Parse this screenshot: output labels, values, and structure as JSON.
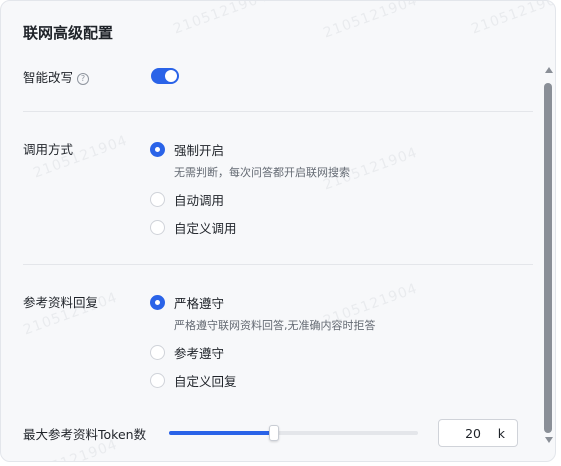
{
  "panel": {
    "title": "联网高级配置",
    "watermark": "2105121904"
  },
  "smart_rewrite": {
    "label": "智能改写",
    "help_icon": "?",
    "enabled": true
  },
  "call_mode": {
    "label": "调用方式",
    "options": [
      {
        "label": "强制开启",
        "selected": true,
        "description": "无需判断，每次问答都开启联网搜索"
      },
      {
        "label": "自动调用",
        "selected": false
      },
      {
        "label": "自定义调用",
        "selected": false
      }
    ]
  },
  "reference_reply": {
    "label": "参考资料回复",
    "options": [
      {
        "label": "严格遵守",
        "selected": true,
        "description": "严格遵守联网资料回答,无准确内容时拒答"
      },
      {
        "label": "参考遵守",
        "selected": false
      },
      {
        "label": "自定义回复",
        "selected": false
      }
    ]
  },
  "max_tokens": {
    "label": "最大参考资料Token数",
    "value": "20",
    "unit": "k",
    "slider_fraction": 0.42
  },
  "colors": {
    "accent": "#2a63e8",
    "background": "#f7f8fa",
    "text": "#1f2329",
    "muted": "#646a73"
  }
}
